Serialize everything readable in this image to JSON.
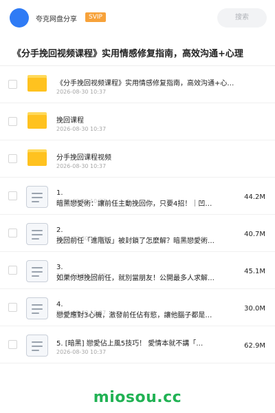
{
  "header": {
    "app_name": "夸克网盘分享",
    "badge": "SVIP",
    "search_placeholder": "搜索"
  },
  "share_title": "《分手挽回视频课程》实用情感修复指南，高效沟通+心理",
  "files": [
    {
      "type": "folder",
      "name": "《分手挽回视频课程》实用情感修复指南，高效沟通+心…",
      "date": "2026-08-30 10:37",
      "size": ""
    },
    {
      "type": "folder",
      "name": "挽回课程",
      "date": "2026-08-30 10:37",
      "size": ""
    },
    {
      "type": "folder",
      "name": "分手挽回课程视频",
      "date": "2026-08-30 10:37",
      "size": ""
    },
    {
      "type": "doc",
      "name_line1": "1.",
      "name_line2": "暗黑戀愛術：讓前任主動挽回你，只要4招！｜凹…",
      "date": "2026-08-30 10:37",
      "size": "44.2M"
    },
    {
      "type": "doc",
      "name_line1": "2.",
      "name_line2": "挽回前任「進階版」被封鎖了怎麼解？暗黑戀愛術…",
      "date": "2026-08-30 10:37",
      "size": "40.7M"
    },
    {
      "type": "doc",
      "name_line1": "3.",
      "name_line2": "如果你想挽回前任，就別當朋友！公開最多人求解…",
      "date": "2026-08-30 10:37",
      "size": "45.1M"
    },
    {
      "type": "doc",
      "name_line1": "4.",
      "name_line2": "戀愛應對3心機，激發前任佔有慾，讓他腦子都是…",
      "date": "2026-08-30 10:37",
      "size": "30.0M"
    },
    {
      "type": "doc",
      "name": "5. [暗黑] 戀愛佔上風5技巧！ 愛情本就不講「…",
      "date": "2026-08-30 10:37",
      "size": "62.9M"
    }
  ],
  "footer": {
    "watermark": "miosou.cc"
  },
  "colors": {
    "accent": "#2f7bf5",
    "svip": "#f7a23a",
    "folder": "#ffc21f",
    "watermark": "#21b254"
  }
}
